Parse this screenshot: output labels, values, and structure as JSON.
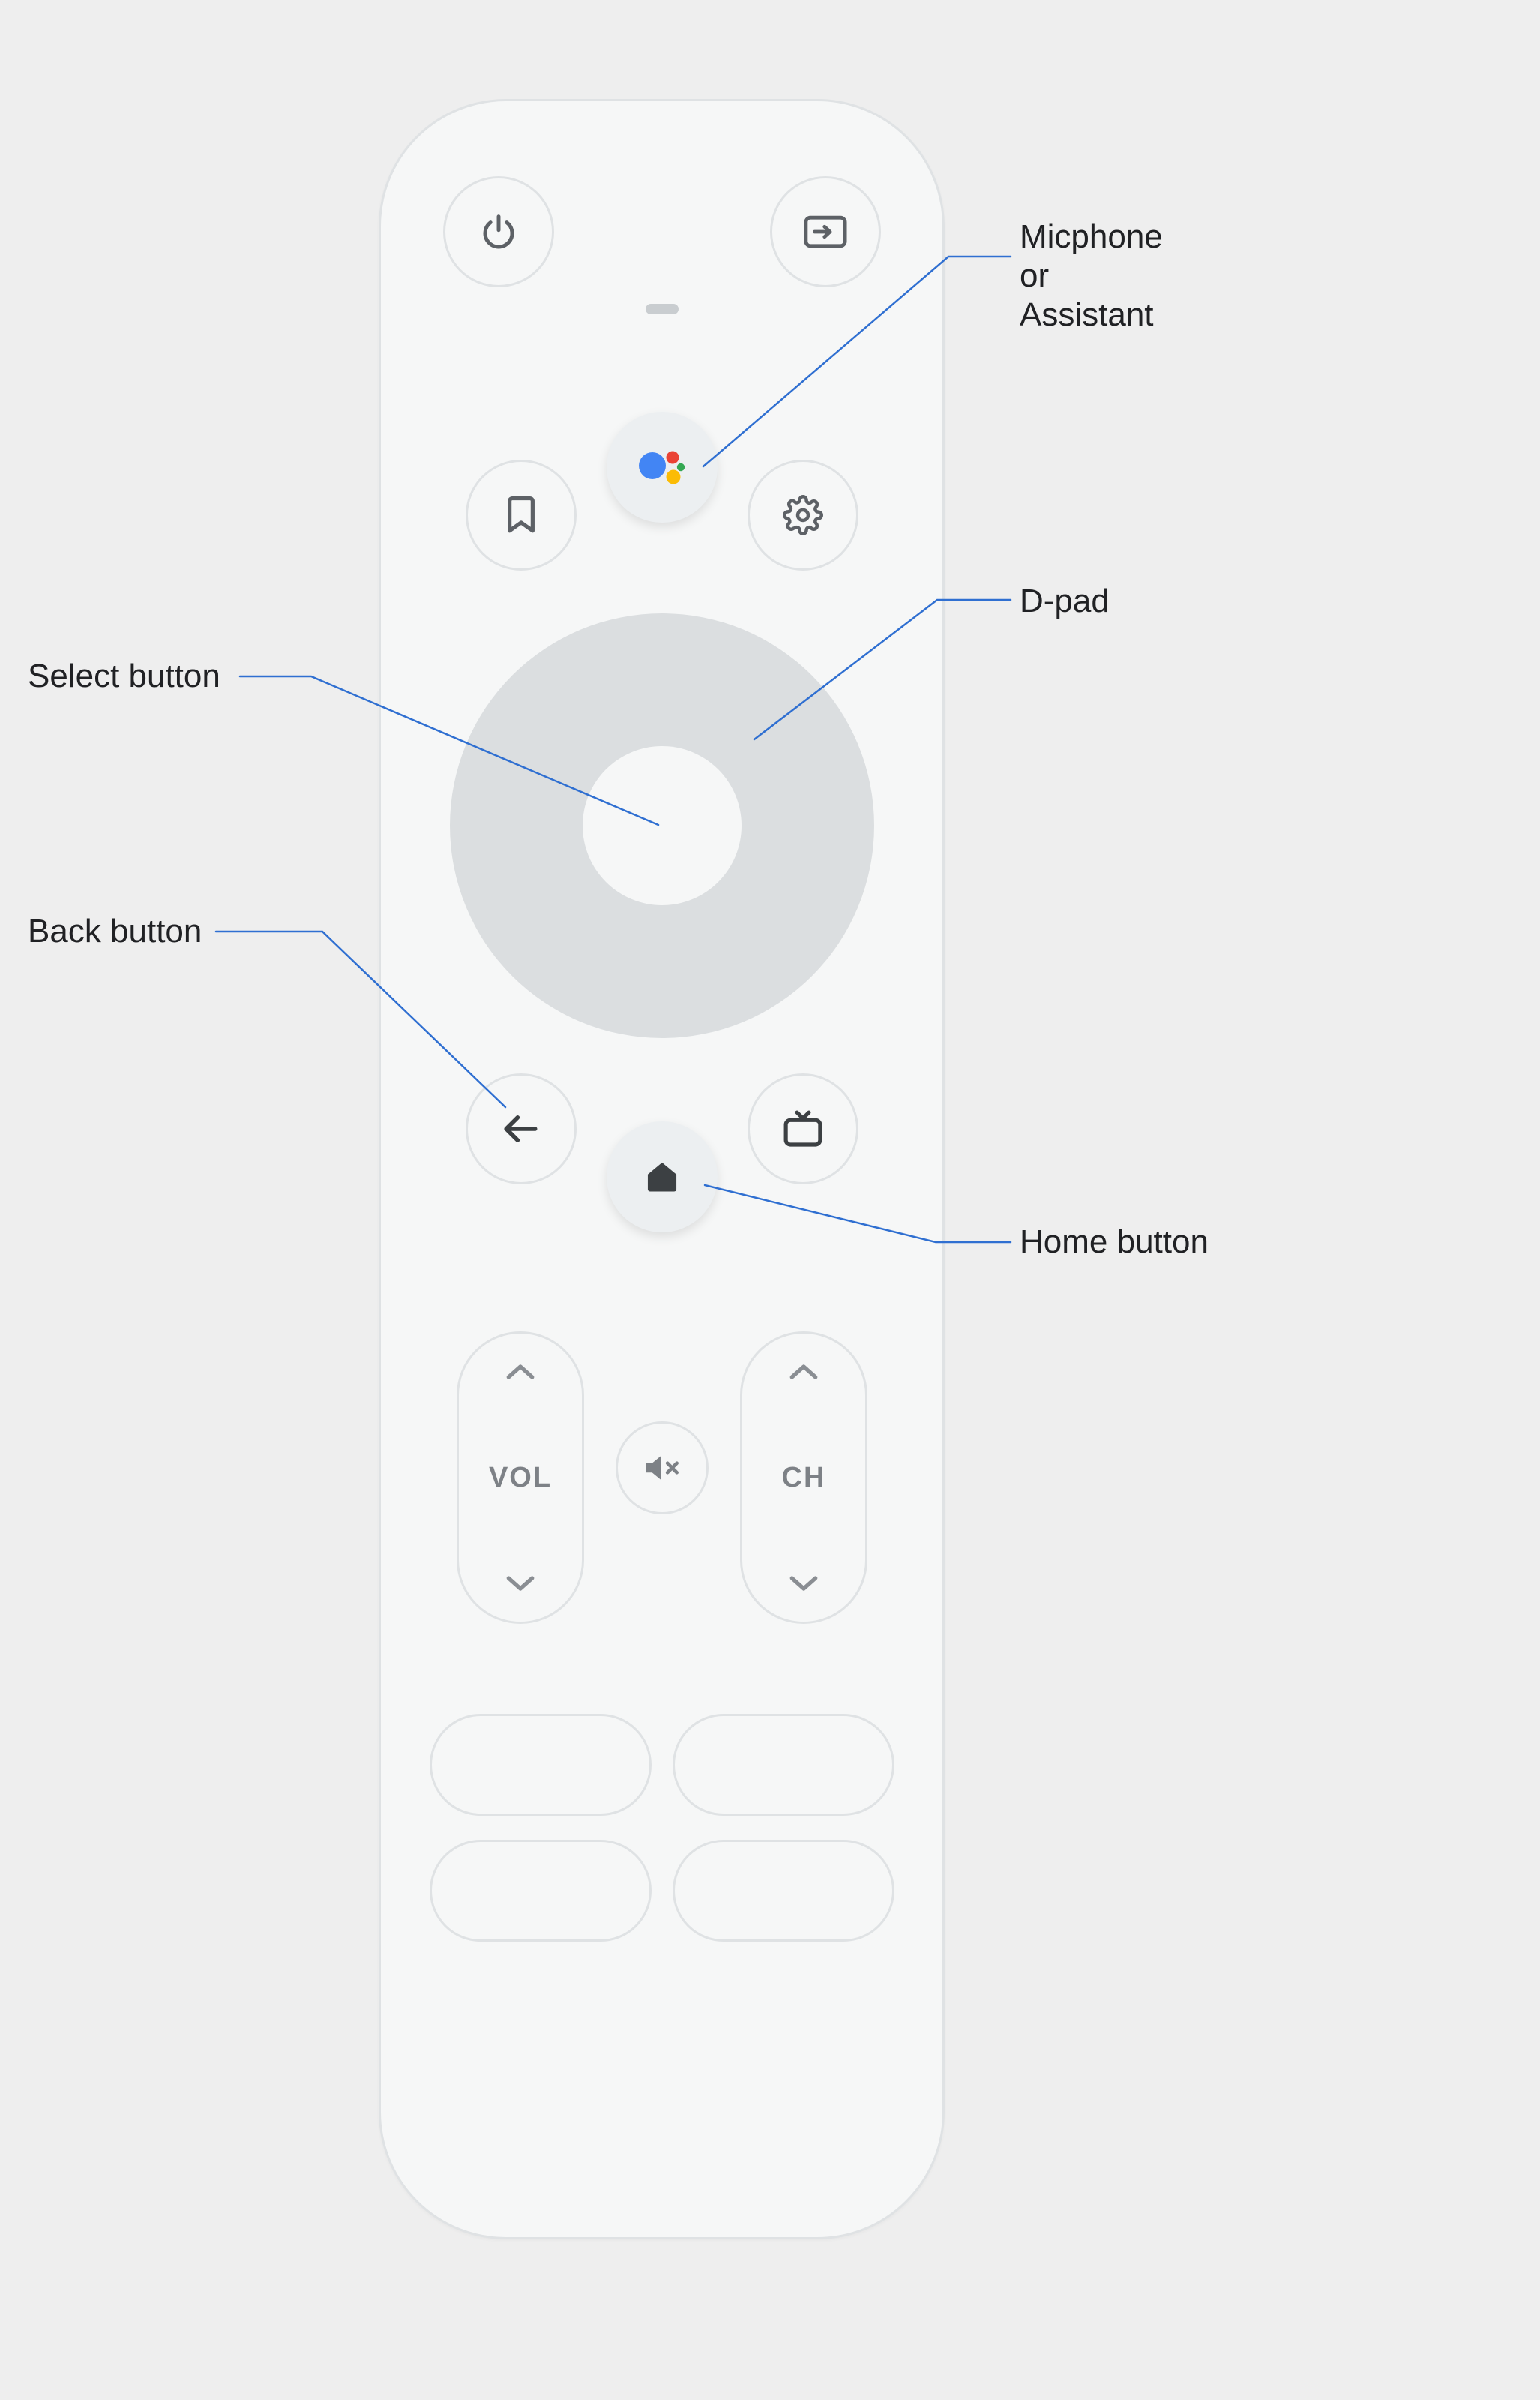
{
  "callouts": {
    "mic": "Micphone\nor\nAssistant",
    "dpad": "D-pad",
    "select": "Select button",
    "back": "Back button",
    "home": "Home button"
  },
  "rockers": {
    "volume_label": "VOL",
    "channel_label": "CH"
  },
  "icons": {
    "power": "power-icon",
    "input": "input-source-icon",
    "assistant": "google-assistant-icon",
    "bookmark": "bookmark-icon",
    "settings": "gear-icon",
    "back": "arrow-left-icon",
    "home": "home-icon",
    "tv": "tv-icon",
    "mute": "volume-mute-icon",
    "caret_up": "chevron-up-icon",
    "caret_down": "chevron-down-icon"
  },
  "colors": {
    "assistant_blue": "#4285F4",
    "assistant_red": "#EA4335",
    "assistant_yellow": "#FBBC05",
    "assistant_green": "#34A853",
    "leader": "#2F6FD1"
  }
}
